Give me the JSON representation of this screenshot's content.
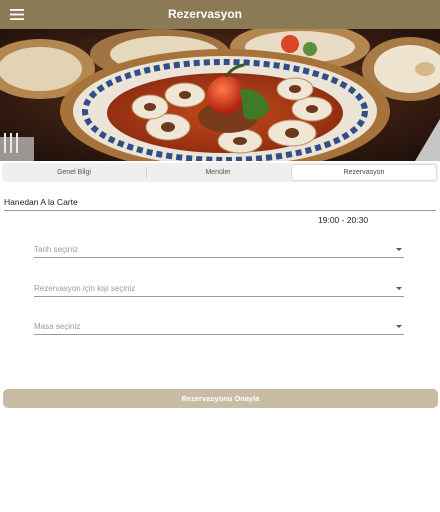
{
  "appbar": {
    "title": "Rezervasyon",
    "menu_icon": "hamburger-menu-icon"
  },
  "hero": {
    "image": "plated-turkish-dish-photo"
  },
  "tabs": [
    {
      "label": "Genel Bilgi",
      "active": false
    },
    {
      "label": "Menüler",
      "active": false
    },
    {
      "label": "Rezervasyon",
      "active": true
    }
  ],
  "restaurant": {
    "name": "Hanedan A la Carte",
    "hours": "19:00 - 20:30"
  },
  "form": {
    "date_placeholder": "Tarih seçiniz",
    "guests_placeholder": "Rezervasyon için kişi seçiniz",
    "table_placeholder": "Masa seçiniz",
    "caret_icon": "dropdown-caret-icon"
  },
  "confirm_button": {
    "label": "Rezervasyonu Onayla"
  },
  "colors": {
    "appbar": "#8a7a56",
    "button": "#c9bca4",
    "tab_bg": "#efefef"
  }
}
